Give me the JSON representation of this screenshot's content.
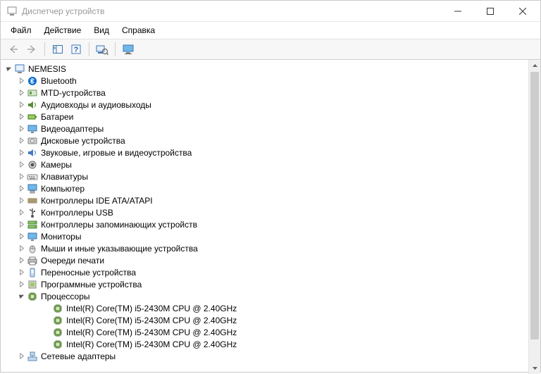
{
  "window": {
    "title": "Диспетчер устройств"
  },
  "menu": {
    "file": "Файл",
    "action": "Действие",
    "view": "Вид",
    "help": "Справка"
  },
  "tree": {
    "root": "NEMESIS",
    "items": [
      {
        "label": "Bluetooth",
        "icon": "bluetooth"
      },
      {
        "label": "MTD-устройства",
        "icon": "mtd"
      },
      {
        "label": "Аудиовходы и аудиовыходы",
        "icon": "audio"
      },
      {
        "label": "Батареи",
        "icon": "battery"
      },
      {
        "label": "Видеоадаптеры",
        "icon": "display"
      },
      {
        "label": "Дисковые устройства",
        "icon": "disk"
      },
      {
        "label": "Звуковые, игровые и видеоустройства",
        "icon": "sound"
      },
      {
        "label": "Камеры",
        "icon": "camera"
      },
      {
        "label": "Клавиатуры",
        "icon": "keyboard"
      },
      {
        "label": "Компьютер",
        "icon": "computer"
      },
      {
        "label": "Контроллеры IDE ATA/ATAPI",
        "icon": "ide"
      },
      {
        "label": "Контроллеры USB",
        "icon": "usb"
      },
      {
        "label": "Контроллеры запоминающих устройств",
        "icon": "storage"
      },
      {
        "label": "Мониторы",
        "icon": "monitor"
      },
      {
        "label": "Мыши и иные указывающие устройства",
        "icon": "mouse"
      },
      {
        "label": "Очереди печати",
        "icon": "printer"
      },
      {
        "label": "Переносные устройства",
        "icon": "portable"
      },
      {
        "label": "Программные устройства",
        "icon": "software"
      },
      {
        "label": "Процессоры",
        "icon": "cpu",
        "expanded": true,
        "children": [
          "Intel(R) Core(TM) i5-2430M CPU @ 2.40GHz",
          "Intel(R) Core(TM) i5-2430M CPU @ 2.40GHz",
          "Intel(R) Core(TM) i5-2430M CPU @ 2.40GHz",
          "Intel(R) Core(TM) i5-2430M CPU @ 2.40GHz"
        ]
      },
      {
        "label": "Сетевые адаптеры",
        "icon": "network"
      }
    ]
  }
}
